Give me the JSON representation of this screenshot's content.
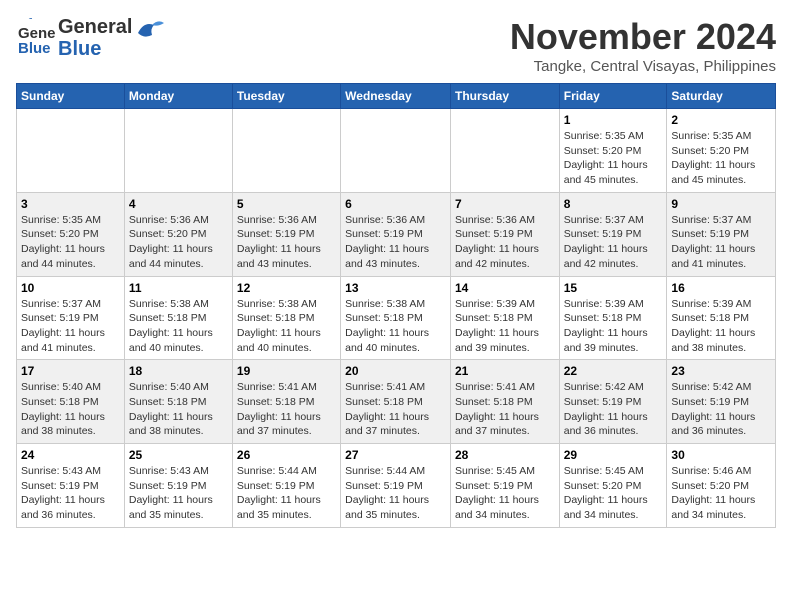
{
  "header": {
    "logo_general": "General",
    "logo_blue": "Blue",
    "month": "November 2024",
    "location": "Tangke, Central Visayas, Philippines"
  },
  "columns": [
    "Sunday",
    "Monday",
    "Tuesday",
    "Wednesday",
    "Thursday",
    "Friday",
    "Saturday"
  ],
  "weeks": [
    [
      {
        "day": "",
        "info": ""
      },
      {
        "day": "",
        "info": ""
      },
      {
        "day": "",
        "info": ""
      },
      {
        "day": "",
        "info": ""
      },
      {
        "day": "",
        "info": ""
      },
      {
        "day": "1",
        "info": "Sunrise: 5:35 AM\nSunset: 5:20 PM\nDaylight: 11 hours and 45 minutes."
      },
      {
        "day": "2",
        "info": "Sunrise: 5:35 AM\nSunset: 5:20 PM\nDaylight: 11 hours and 45 minutes."
      }
    ],
    [
      {
        "day": "3",
        "info": "Sunrise: 5:35 AM\nSunset: 5:20 PM\nDaylight: 11 hours and 44 minutes."
      },
      {
        "day": "4",
        "info": "Sunrise: 5:36 AM\nSunset: 5:20 PM\nDaylight: 11 hours and 44 minutes."
      },
      {
        "day": "5",
        "info": "Sunrise: 5:36 AM\nSunset: 5:19 PM\nDaylight: 11 hours and 43 minutes."
      },
      {
        "day": "6",
        "info": "Sunrise: 5:36 AM\nSunset: 5:19 PM\nDaylight: 11 hours and 43 minutes."
      },
      {
        "day": "7",
        "info": "Sunrise: 5:36 AM\nSunset: 5:19 PM\nDaylight: 11 hours and 42 minutes."
      },
      {
        "day": "8",
        "info": "Sunrise: 5:37 AM\nSunset: 5:19 PM\nDaylight: 11 hours and 42 minutes."
      },
      {
        "day": "9",
        "info": "Sunrise: 5:37 AM\nSunset: 5:19 PM\nDaylight: 11 hours and 41 minutes."
      }
    ],
    [
      {
        "day": "10",
        "info": "Sunrise: 5:37 AM\nSunset: 5:19 PM\nDaylight: 11 hours and 41 minutes."
      },
      {
        "day": "11",
        "info": "Sunrise: 5:38 AM\nSunset: 5:18 PM\nDaylight: 11 hours and 40 minutes."
      },
      {
        "day": "12",
        "info": "Sunrise: 5:38 AM\nSunset: 5:18 PM\nDaylight: 11 hours and 40 minutes."
      },
      {
        "day": "13",
        "info": "Sunrise: 5:38 AM\nSunset: 5:18 PM\nDaylight: 11 hours and 40 minutes."
      },
      {
        "day": "14",
        "info": "Sunrise: 5:39 AM\nSunset: 5:18 PM\nDaylight: 11 hours and 39 minutes."
      },
      {
        "day": "15",
        "info": "Sunrise: 5:39 AM\nSunset: 5:18 PM\nDaylight: 11 hours and 39 minutes."
      },
      {
        "day": "16",
        "info": "Sunrise: 5:39 AM\nSunset: 5:18 PM\nDaylight: 11 hours and 38 minutes."
      }
    ],
    [
      {
        "day": "17",
        "info": "Sunrise: 5:40 AM\nSunset: 5:18 PM\nDaylight: 11 hours and 38 minutes."
      },
      {
        "day": "18",
        "info": "Sunrise: 5:40 AM\nSunset: 5:18 PM\nDaylight: 11 hours and 38 minutes."
      },
      {
        "day": "19",
        "info": "Sunrise: 5:41 AM\nSunset: 5:18 PM\nDaylight: 11 hours and 37 minutes."
      },
      {
        "day": "20",
        "info": "Sunrise: 5:41 AM\nSunset: 5:18 PM\nDaylight: 11 hours and 37 minutes."
      },
      {
        "day": "21",
        "info": "Sunrise: 5:41 AM\nSunset: 5:18 PM\nDaylight: 11 hours and 37 minutes."
      },
      {
        "day": "22",
        "info": "Sunrise: 5:42 AM\nSunset: 5:19 PM\nDaylight: 11 hours and 36 minutes."
      },
      {
        "day": "23",
        "info": "Sunrise: 5:42 AM\nSunset: 5:19 PM\nDaylight: 11 hours and 36 minutes."
      }
    ],
    [
      {
        "day": "24",
        "info": "Sunrise: 5:43 AM\nSunset: 5:19 PM\nDaylight: 11 hours and 36 minutes."
      },
      {
        "day": "25",
        "info": "Sunrise: 5:43 AM\nSunset: 5:19 PM\nDaylight: 11 hours and 35 minutes."
      },
      {
        "day": "26",
        "info": "Sunrise: 5:44 AM\nSunset: 5:19 PM\nDaylight: 11 hours and 35 minutes."
      },
      {
        "day": "27",
        "info": "Sunrise: 5:44 AM\nSunset: 5:19 PM\nDaylight: 11 hours and 35 minutes."
      },
      {
        "day": "28",
        "info": "Sunrise: 5:45 AM\nSunset: 5:19 PM\nDaylight: 11 hours and 34 minutes."
      },
      {
        "day": "29",
        "info": "Sunrise: 5:45 AM\nSunset: 5:20 PM\nDaylight: 11 hours and 34 minutes."
      },
      {
        "day": "30",
        "info": "Sunrise: 5:46 AM\nSunset: 5:20 PM\nDaylight: 11 hours and 34 minutes."
      }
    ]
  ]
}
